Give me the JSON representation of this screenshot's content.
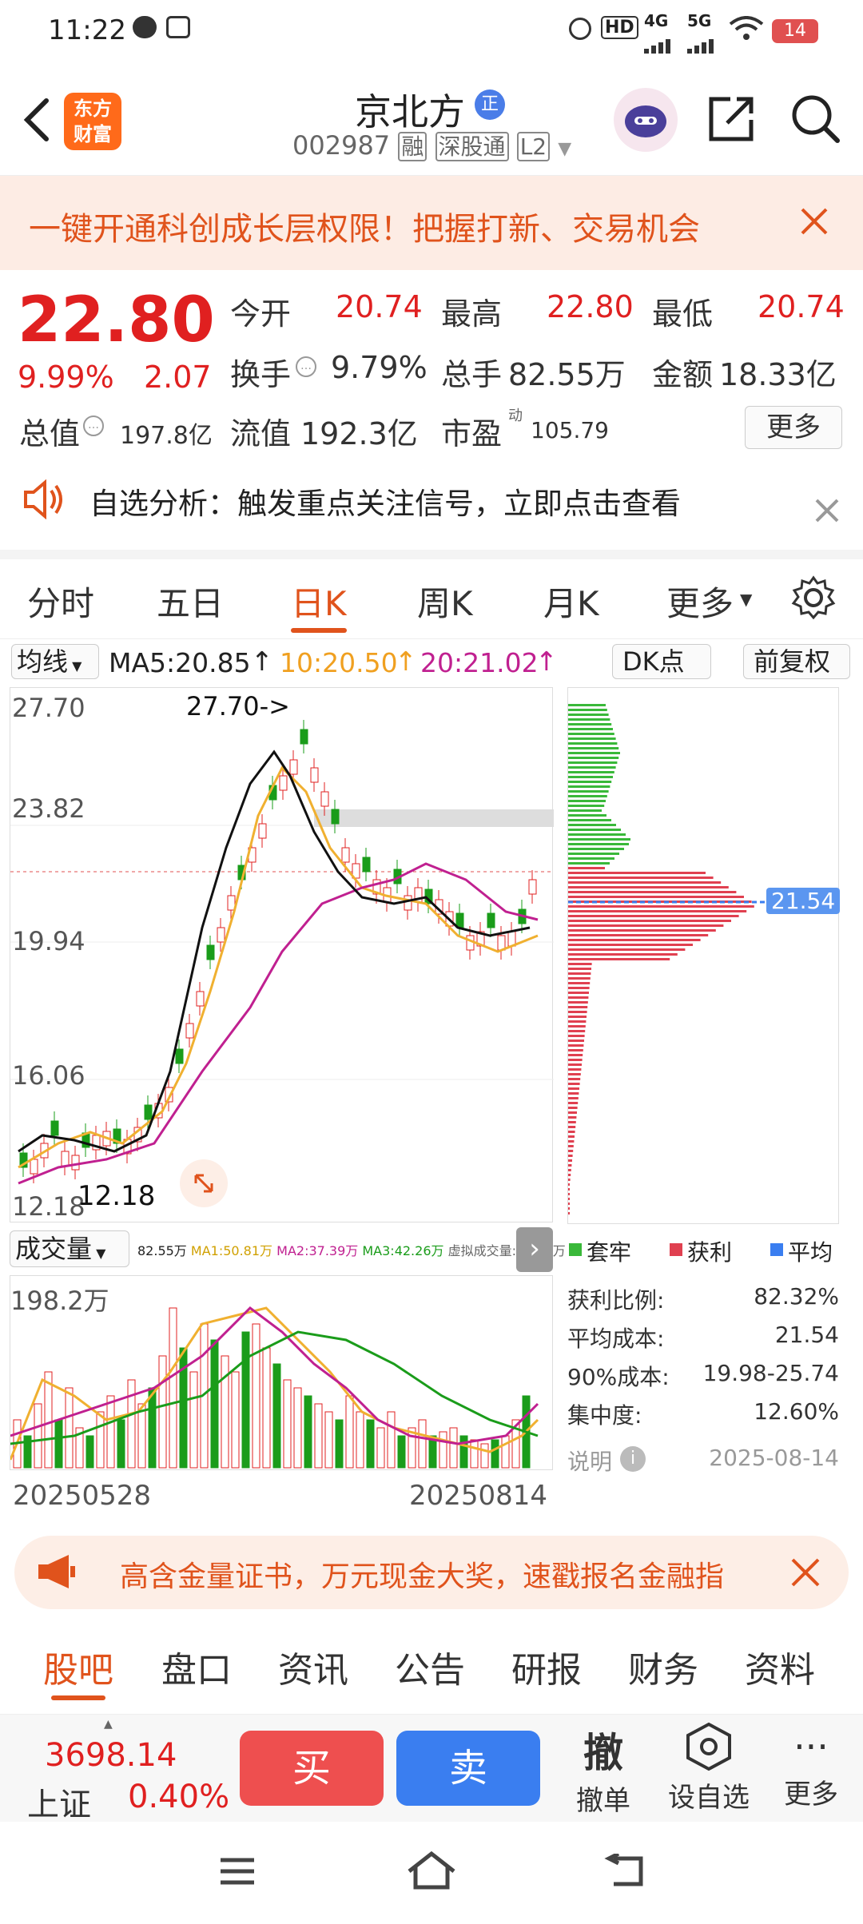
{
  "status": {
    "time": "11:22",
    "battery": "14",
    "network1": "HD",
    "network2": "4G",
    "network3": "5G"
  },
  "header": {
    "logo_line1": "东方",
    "logo_line2": "财富",
    "title": "京北方",
    "title_badge": "正",
    "code": "002987",
    "tag1": "融",
    "tag2": "深股通",
    "tag3": "L2"
  },
  "banner": {
    "text": "一键开通科创成长层权限！把握打新、交易机会"
  },
  "quote": {
    "price": "22.80",
    "change_pct": "9.99%",
    "change": "2.07",
    "open_label": "今开",
    "open": "20.74",
    "high_label": "最高",
    "high": "22.80",
    "low_label": "最低",
    "low": "20.74",
    "turnover_label": "换手",
    "turnover": "9.79%",
    "volume_label": "总手",
    "volume": "82.55万",
    "amount_label": "金额",
    "amount": "18.33亿",
    "mcap_label": "总值",
    "mcap": "197.8亿",
    "float_label": "流值",
    "float": "192.3亿",
    "pe_label": "市盈",
    "pe_sup": "动",
    "pe": "105.79",
    "more": "更多"
  },
  "notice": {
    "text": "自选分析：触发重点关注信号，立即点击查看"
  },
  "tabs": [
    "分时",
    "五日",
    "日K",
    "周K",
    "月K",
    "更多"
  ],
  "ma": {
    "selector": "均线",
    "ma5": "MA5:20.85",
    "ma10": "10:20.50",
    "ma20": "20:21.02",
    "dk": "DK点",
    "fq": "前复权"
  },
  "chart": {
    "y1": "27.70",
    "y2": "23.82",
    "y3": "19.94",
    "y4": "16.06",
    "y5": "12.18",
    "high_label": "27.70->",
    "low_label": "12.18",
    "chip_price": "21.54",
    "vol_selector": "成交量",
    "vol_info": "82.55万",
    "vol_ma1": "MA1:50.81万",
    "vol_ma2": "MA2:37.39万",
    "vol_ma3": "MA3:42.26万",
    "vol_virtual": "虚拟成交量:108.0万",
    "vol_max": "198.2万",
    "date_start": "20250528",
    "date_end": "20250814"
  },
  "chips": {
    "legend1": "套牢",
    "legend2": "获利",
    "legend3": "平均",
    "profit_label": "获利比例:",
    "profit": "82.32%",
    "avg_label": "平均成本:",
    "avg": "21.54",
    "c90_label": "90%成本:",
    "c90": "19.98-25.74",
    "conc_label": "集中度:",
    "conc": "12.60%",
    "note": "说明",
    "date": "2025-08-14"
  },
  "promo": {
    "text": "高含金量证书，万元现金大奖，速戳报名金融指"
  },
  "bottom_tabs": [
    "股吧",
    "盘口",
    "资讯",
    "公告",
    "研报",
    "财务",
    "资料"
  ],
  "bottom": {
    "index_value": "3698.14",
    "index_name": "上证",
    "index_pct": "0.40%",
    "buy": "买",
    "sell": "卖",
    "cancel_icon_text": "撤",
    "cancel": "撤单",
    "watch": "设自选",
    "more": "更多"
  },
  "colors": {
    "up": "#e02020",
    "down": "#1a9c1a",
    "accent": "#e0531c",
    "buy": "#ee4f4f",
    "sell": "#3a7ef0"
  }
}
